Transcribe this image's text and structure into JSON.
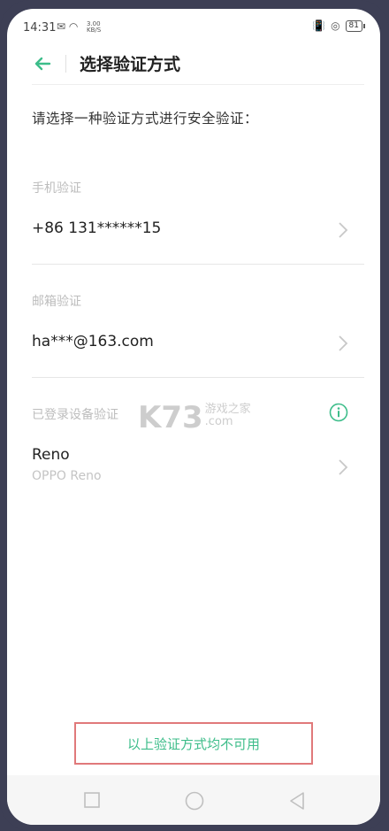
{
  "status_bar": {
    "time": "14:31",
    "network_speed": "3.00",
    "network_unit": "KB/S",
    "battery": "81"
  },
  "header": {
    "title": "选择验证方式"
  },
  "prompt": "请选择一种验证方式进行安全验证：",
  "sections": {
    "phone": {
      "label": "手机验证",
      "value": "+86 131******15"
    },
    "email": {
      "label": "邮箱验证",
      "value": "ha***@163.com"
    },
    "device": {
      "label": "已登录设备验证",
      "name": "Reno",
      "model": "OPPO Reno"
    }
  },
  "watermark": {
    "big": "K73",
    "small_top": "游戏之家",
    "small_bottom": ".com"
  },
  "footer": {
    "unavailable_label": "以上验证方式均不可用"
  },
  "colors": {
    "accent": "#3dbd8a",
    "highlight_border": "#e0797a"
  }
}
